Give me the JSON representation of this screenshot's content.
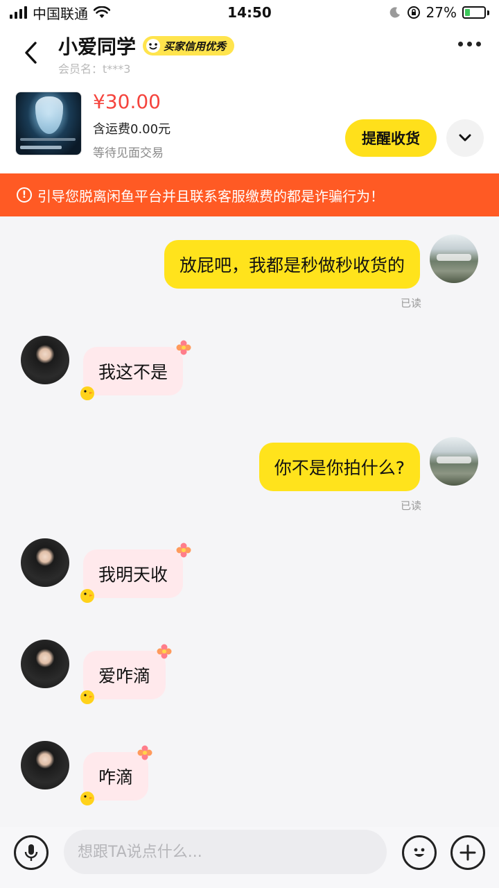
{
  "status_bar": {
    "carrier": "中国联通",
    "time": "14:50",
    "battery_percent": "27%",
    "battery_level": 0.27
  },
  "header": {
    "title": "小爱同学",
    "credit_badge": "买家信用优秀",
    "member_label": "会员名：t***3"
  },
  "item": {
    "price": "¥30.00",
    "shipping": "含运费0.00元",
    "trade_status": "等待见面交易",
    "remind_button": "提醒收货"
  },
  "warning": {
    "text": "引导您脱离闲鱼平台并且联系客服缴费的都是诈骗行为！"
  },
  "messages": [
    {
      "from": "me",
      "text": "放屁吧，我都是秒做秒收货的",
      "status": "已读"
    },
    {
      "from": "ta",
      "text": "我这不是"
    },
    {
      "from": "me",
      "text": "你不是你拍什么?",
      "status": "已读"
    },
    {
      "from": "ta",
      "text": "我明天收"
    },
    {
      "from": "ta",
      "text": "爱咋滴"
    },
    {
      "from": "ta",
      "text": "咋滴"
    }
  ],
  "input": {
    "placeholder": "想跟TA说点什么..."
  },
  "colors": {
    "accent_yellow": "#ffe31c",
    "price_red": "#f5443d",
    "warning_orange": "#ff5a24",
    "ta_bubble": "#ffe9ec"
  }
}
